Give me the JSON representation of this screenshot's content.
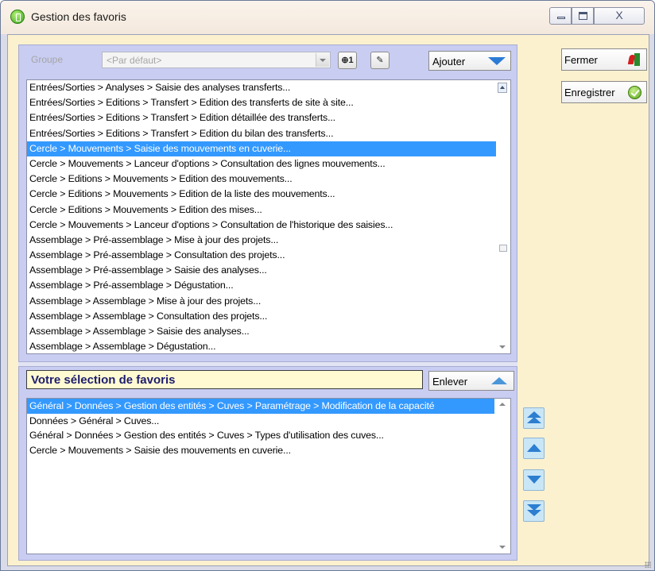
{
  "window": {
    "title": "Gestion des favoris",
    "controls": {
      "close_glyph": "X"
    }
  },
  "groupe": {
    "label": "Groupe",
    "value": "<Par défaut>",
    "add_group_glyph": "⊕1",
    "edit_group_glyph": "✎"
  },
  "ajouter": {
    "label": "Ajouter"
  },
  "available_list": {
    "selected_index": 4,
    "items": [
      "Entrées/Sorties > Analyses > Saisie des analyses transferts...",
      "Entrées/Sorties > Editions > Transfert > Edition des transferts de site à site...",
      "Entrées/Sorties > Editions > Transfert > Edition détaillée des transferts...",
      "Entrées/Sorties > Editions > Transfert > Edition du bilan des transferts...",
      "Cercle > Mouvements > Saisie des mouvements en cuverie...",
      "Cercle > Mouvements > Lanceur d'options > Consultation des lignes mouvements...",
      "Cercle > Editions > Mouvements > Edition des mouvements...",
      "Cercle > Editions > Mouvements > Edition de la liste des mouvements...",
      "Cercle > Editions > Mouvements > Edition des mises...",
      "Cercle > Mouvements > Lanceur d'options > Consultation de l'historique des saisies...",
      "Assemblage > Pré-assemblage > Mise à jour des projets...",
      "Assemblage > Pré-assemblage > Consultation des projets...",
      "Assemblage > Pré-assemblage > Saisie des analyses...",
      "Assemblage > Pré-assemblage > Dégustation...",
      "Assemblage > Assemblage > Mise à jour des projets...",
      "Assemblage > Assemblage > Consultation des projets...",
      "Assemblage > Assemblage > Saisie des analyses...",
      "Assemblage > Assemblage > Dégustation..."
    ]
  },
  "selection": {
    "title": "Votre sélection de favoris",
    "remove_label": "Enlever",
    "selected_index": 0,
    "items": [
      "Général > Données > Gestion des entités > Cuves > Paramétrage > Modification de la capacité",
      "Données > Général > Cuves...",
      "Général > Données > Gestion des entités > Cuves > Types d'utilisation des cuves...",
      "Cercle > Mouvements > Saisie des mouvements en cuverie..."
    ]
  },
  "side_buttons": {
    "fermer": "Fermer",
    "enregistrer": "Enregistrer"
  },
  "colors": {
    "selection_blue": "#3399ff",
    "pane_lavender": "#c9cdf2",
    "frame_cream": "#fbf1cf",
    "title_navy": "#1d1d6e",
    "arrow_blue": "#2c7ed0"
  }
}
